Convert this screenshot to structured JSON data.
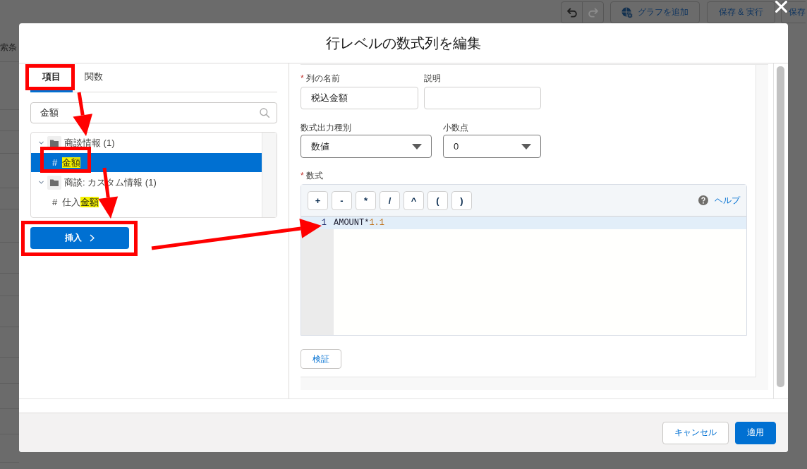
{
  "background_page": {
    "toolbar": {
      "history_buttons": [
        {
          "kind": "undo",
          "disabled": false
        },
        {
          "kind": "redo",
          "disabled": true
        }
      ],
      "buttons": [
        {
          "kind": "icon-label",
          "label": "グラフを追加"
        },
        {
          "kind": "label",
          "label": "保存 & 実行"
        },
        {
          "kind": "label",
          "label": "保存"
        }
      ]
    },
    "side_text": "索条"
  },
  "dialog": {
    "title": "行レベルの数式列を編集",
    "left_panel": {
      "tabs": [
        {
          "label": "項目",
          "selected": true
        },
        {
          "label": "関数",
          "selected": false
        }
      ],
      "search": {
        "value": "金額"
      },
      "tree": [
        {
          "label": "商談情報 (1)",
          "expanded": true,
          "children": [
            {
              "glyph": "#",
              "parts": [
                {
                  "text": "金額",
                  "highlighted": true
                }
              ],
              "selected": true
            }
          ]
        },
        {
          "label": "商談: カスタム情報 (1)",
          "expanded": true,
          "children": [
            {
              "glyph": "#",
              "parts": [
                {
                  "text": "仕入",
                  "highlighted": false
                },
                {
                  "text": "金額",
                  "highlighted": true
                }
              ],
              "selected": false
            }
          ]
        }
      ],
      "insert_button": {
        "label": "挿入"
      }
    },
    "form": {
      "text_fields": [
        {
          "required_mark": "*",
          "label": "列の名前",
          "value": "税込金額"
        },
        {
          "label": "説明"
        }
      ],
      "selects": [
        {
          "label": "数式出力種別",
          "value": "数値"
        },
        {
          "label": "小数点",
          "value": "0"
        }
      ],
      "formula": {
        "required_mark": "*",
        "label": "数式",
        "operators": [
          "+",
          "-",
          "*",
          "/",
          "^",
          "(",
          ")"
        ],
        "help_link": "ヘルプ",
        "lines": [
          {
            "number": "1",
            "active": true,
            "tokens": [
              {
                "kind": "identifier",
                "text": "AMOUNT"
              },
              {
                "kind": "operator",
                "text": "*"
              },
              {
                "kind": "number",
                "text": "1.1"
              }
            ]
          }
        ]
      },
      "validate_button": "検証"
    },
    "footer_buttons": [
      {
        "kind": "neutral",
        "label": "キャンセル"
      },
      {
        "kind": "brand",
        "label": "適用"
      }
    ]
  },
  "annotations": [
    {
      "kind": "frame"
    },
    {
      "kind": "frame"
    },
    {
      "kind": "frame"
    },
    {
      "kind": "arrow"
    },
    {
      "kind": "arrow"
    },
    {
      "kind": "arrow"
    }
  ]
}
